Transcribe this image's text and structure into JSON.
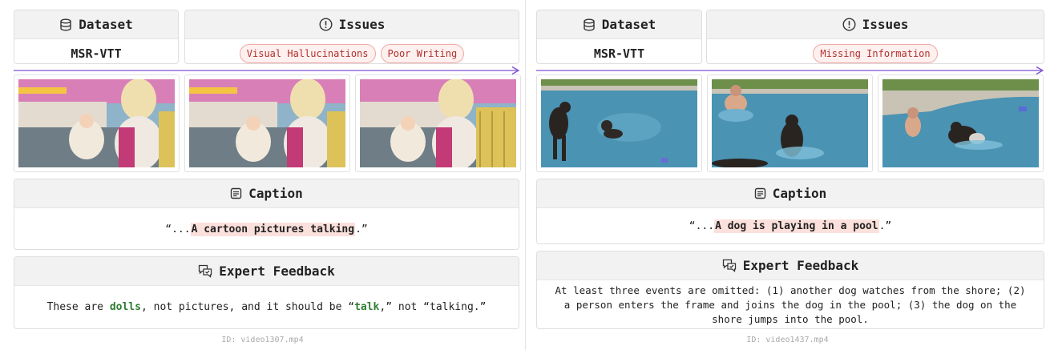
{
  "left": {
    "dataset_header": "Dataset",
    "dataset_value": "MSR-VTT",
    "issues_header": "Issues",
    "tags": [
      "Visual Hallucinations",
      "Poor Writing"
    ],
    "caption_header": "Caption",
    "caption_pre": "“...",
    "caption_hl": "A cartoon pictures talking",
    "caption_post": ".”",
    "feedback_header": "Expert Feedback",
    "feedback_1": "These are ",
    "feedback_2": "dolls",
    "feedback_3": ", not pictures, and it should be “",
    "feedback_4": "talk",
    "feedback_5": ",” not “talking.”",
    "id": "ID: video1307.mp4"
  },
  "right": {
    "dataset_header": "Dataset",
    "dataset_value": "MSR-VTT",
    "issues_header": "Issues",
    "tags": [
      "Missing Information"
    ],
    "caption_header": "Caption",
    "caption_pre": "“...",
    "caption_hl": "A dog is playing in a pool",
    "caption_post": ".”",
    "feedback_header": "Expert Feedback",
    "feedback": "At least three events are omitted: (1) another dog watches from the shore; (2) a person enters the frame and joins the dog in the pool; (3) the dog on the shore jumps into the pool.",
    "id": "ID: video1437.mp4"
  },
  "colors": {
    "arrow": "#7b4fd6",
    "tag_red": "#b3312c",
    "highlight": "#fbe0dc",
    "green": "#2e7d32"
  },
  "icons": {
    "dataset": "database-icon",
    "issues": "exclamation-circle-icon",
    "caption": "caption-icon",
    "feedback": "chat-feedback-icon"
  }
}
